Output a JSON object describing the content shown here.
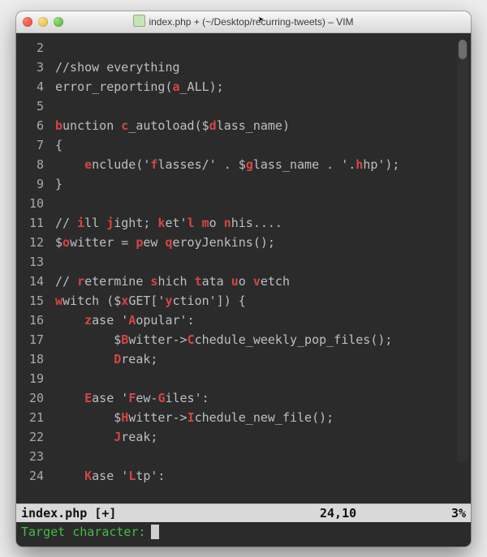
{
  "window": {
    "title": "index.php + (~/Desktop/recurring-tweets) – VIM"
  },
  "gutter": [
    "2",
    "3",
    "4",
    "5",
    "6",
    "7",
    "8",
    "9",
    "10",
    "11",
    "12",
    "13",
    "14",
    "15",
    "16",
    "17",
    "18",
    "19",
    "20",
    "21",
    "22",
    "23",
    "24"
  ],
  "lines": [
    {
      "indent": 0,
      "segs": []
    },
    {
      "indent": 0,
      "segs": [
        {
          "t": "//show everything"
        }
      ]
    },
    {
      "indent": 0,
      "segs": [
        {
          "t": "error_reporting("
        },
        {
          "t": "a",
          "c": "hl"
        },
        {
          "t": "_ALL);"
        }
      ]
    },
    {
      "indent": 0,
      "segs": []
    },
    {
      "indent": 0,
      "segs": [
        {
          "t": "b",
          "c": "hl"
        },
        {
          "t": "unction "
        },
        {
          "t": "c",
          "c": "hl"
        },
        {
          "t": "_autoload($"
        },
        {
          "t": "d",
          "c": "hl"
        },
        {
          "t": "lass_name)"
        }
      ]
    },
    {
      "indent": 0,
      "segs": [
        {
          "t": "{"
        }
      ]
    },
    {
      "indent": 1,
      "segs": [
        {
          "t": "e",
          "c": "hl"
        },
        {
          "t": "nclude('"
        },
        {
          "t": "f",
          "c": "hl"
        },
        {
          "t": "lasses/' . $"
        },
        {
          "t": "g",
          "c": "hl"
        },
        {
          "t": "lass_name . '."
        },
        {
          "t": "h",
          "c": "hl"
        },
        {
          "t": "hp');"
        }
      ]
    },
    {
      "indent": 0,
      "segs": [
        {
          "t": "}"
        }
      ]
    },
    {
      "indent": 0,
      "segs": []
    },
    {
      "indent": 0,
      "segs": [
        {
          "t": "// "
        },
        {
          "t": "i",
          "c": "hl"
        },
        {
          "t": "ll "
        },
        {
          "t": "j",
          "c": "hl"
        },
        {
          "t": "ight; "
        },
        {
          "t": "k",
          "c": "hl"
        },
        {
          "t": "et'"
        },
        {
          "t": "l",
          "c": "hl"
        },
        {
          "t": " "
        },
        {
          "t": "m",
          "c": "hl"
        },
        {
          "t": "o "
        },
        {
          "t": "n",
          "c": "hl"
        },
        {
          "t": "his...."
        }
      ]
    },
    {
      "indent": 0,
      "segs": [
        {
          "t": "$"
        },
        {
          "t": "o",
          "c": "hl"
        },
        {
          "t": "witter = "
        },
        {
          "t": "p",
          "c": "hl"
        },
        {
          "t": "ew "
        },
        {
          "t": "q",
          "c": "hl"
        },
        {
          "t": "eroyJenkins();"
        }
      ]
    },
    {
      "indent": 0,
      "segs": []
    },
    {
      "indent": 0,
      "segs": [
        {
          "t": "// "
        },
        {
          "t": "r",
          "c": "hl"
        },
        {
          "t": "etermine "
        },
        {
          "t": "s",
          "c": "hl"
        },
        {
          "t": "hich "
        },
        {
          "t": "t",
          "c": "hl"
        },
        {
          "t": "ata "
        },
        {
          "t": "u",
          "c": "hl"
        },
        {
          "t": "o "
        },
        {
          "t": "v",
          "c": "hl"
        },
        {
          "t": "etch"
        }
      ]
    },
    {
      "indent": 0,
      "segs": [
        {
          "t": "w",
          "c": "hl"
        },
        {
          "t": "witch ($"
        },
        {
          "t": "x",
          "c": "hl"
        },
        {
          "t": "GET['"
        },
        {
          "t": "y",
          "c": "hl"
        },
        {
          "t": "ction']) {"
        }
      ]
    },
    {
      "indent": 1,
      "segs": [
        {
          "t": "z",
          "c": "hl"
        },
        {
          "t": "ase '"
        },
        {
          "t": "A",
          "c": "hlb"
        },
        {
          "t": "opular':"
        }
      ]
    },
    {
      "indent": 2,
      "segs": [
        {
          "t": "$"
        },
        {
          "t": "B",
          "c": "hlb"
        },
        {
          "t": "witter->"
        },
        {
          "t": "C",
          "c": "hlb"
        },
        {
          "t": "chedule_weekly_pop_files();"
        }
      ]
    },
    {
      "indent": 2,
      "segs": [
        {
          "t": "D",
          "c": "hlb"
        },
        {
          "t": "reak;"
        }
      ]
    },
    {
      "indent": 0,
      "segs": []
    },
    {
      "indent": 1,
      "segs": [
        {
          "t": "E",
          "c": "hlb"
        },
        {
          "t": "ase '"
        },
        {
          "t": "F",
          "c": "hlb"
        },
        {
          "t": "ew-"
        },
        {
          "t": "G",
          "c": "hlb"
        },
        {
          "t": "iles':"
        }
      ]
    },
    {
      "indent": 2,
      "segs": [
        {
          "t": "$"
        },
        {
          "t": "H",
          "c": "hlb"
        },
        {
          "t": "witter->"
        },
        {
          "t": "I",
          "c": "hlb"
        },
        {
          "t": "chedule_new_file();"
        }
      ]
    },
    {
      "indent": 2,
      "segs": [
        {
          "t": "J",
          "c": "hlb"
        },
        {
          "t": "reak;"
        }
      ]
    },
    {
      "indent": 0,
      "segs": []
    },
    {
      "indent": 1,
      "segs": [
        {
          "t": "K",
          "c": "hlb"
        },
        {
          "t": "ase '"
        },
        {
          "t": "L",
          "c": "hlb"
        },
        {
          "t": "tp':"
        }
      ]
    }
  ],
  "status": {
    "file": "index.php [+]",
    "pos": "24,10",
    "pct": "3%"
  },
  "cmdline": {
    "prompt": "Target character:"
  }
}
